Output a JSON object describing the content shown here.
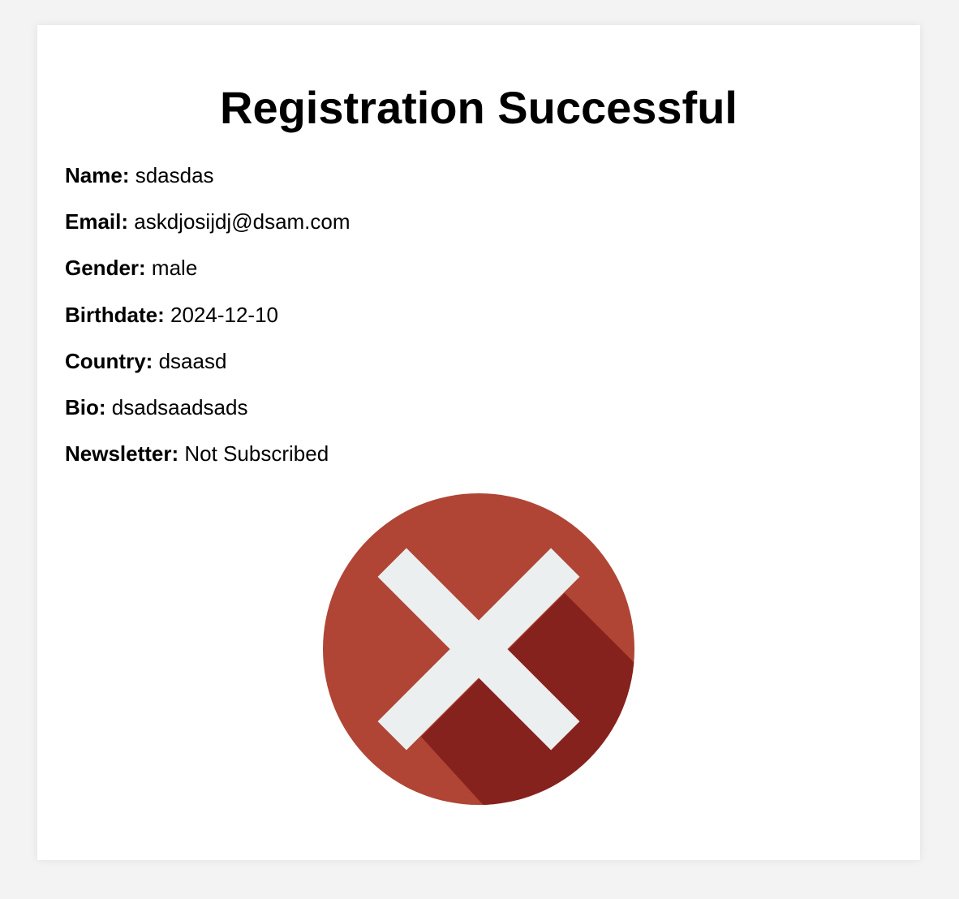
{
  "page": {
    "title": "Registration Successful"
  },
  "fields": [
    {
      "label": "Name:",
      "value": "sdasdas"
    },
    {
      "label": "Email:",
      "value": "askdjosijdj@dsam.com"
    },
    {
      "label": "Gender:",
      "value": "male"
    },
    {
      "label": "Birthdate:",
      "value": "2024-12-10"
    },
    {
      "label": "Country:",
      "value": "dsaasd"
    },
    {
      "label": "Bio:",
      "value": "dsadsaadsads"
    },
    {
      "label": "Newsletter:",
      "value": "Not Subscribed"
    }
  ],
  "status_icon": {
    "name": "close-x-icon",
    "colors": {
      "circle": "#b04535",
      "shadow": "#86221d",
      "cross": "#eceff0"
    }
  }
}
